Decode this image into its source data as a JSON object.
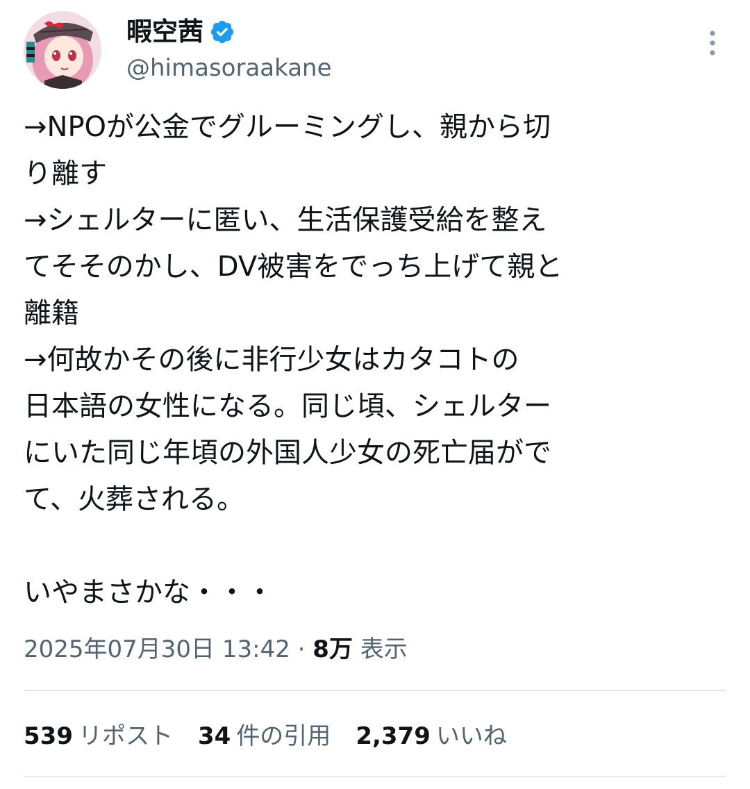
{
  "author": {
    "display_name": "暇空茜",
    "handle": "@himasoraakane",
    "verified": true,
    "avatar": "avatar-anime-girl"
  },
  "tweet": {
    "text": "→NPOが公金でグルーミングし、親から切\nり離す\n→シェルターに匿い、生活保護受給を整え\nてそそのかし、DV被害をでっち上げて親と\n離籍\n→何故かその後に非行少女はカタコトの\n日本語の女性になる。同じ頃、シェルター\nにいた同じ年頃の外国人少女の死亡届がで\nて、火葬される。\n\nいやまさかな・・・"
  },
  "meta": {
    "timestamp": "2025年07月30日 13:42",
    "separator": "·",
    "views_count": "8万",
    "views_label": "表示"
  },
  "stats": {
    "reposts_count": "539",
    "reposts_label": "リポスト",
    "quotes_count": "34",
    "quotes_label": "件の引用",
    "likes_count": "2,379",
    "likes_label": "いいね"
  },
  "colors": {
    "text": "#0f1419",
    "secondary": "#536471",
    "verified": "#1d9bf0",
    "divider": "#cfd9de"
  },
  "icons": {
    "verified": "verified-badge-icon",
    "more": "more-options-icon"
  }
}
